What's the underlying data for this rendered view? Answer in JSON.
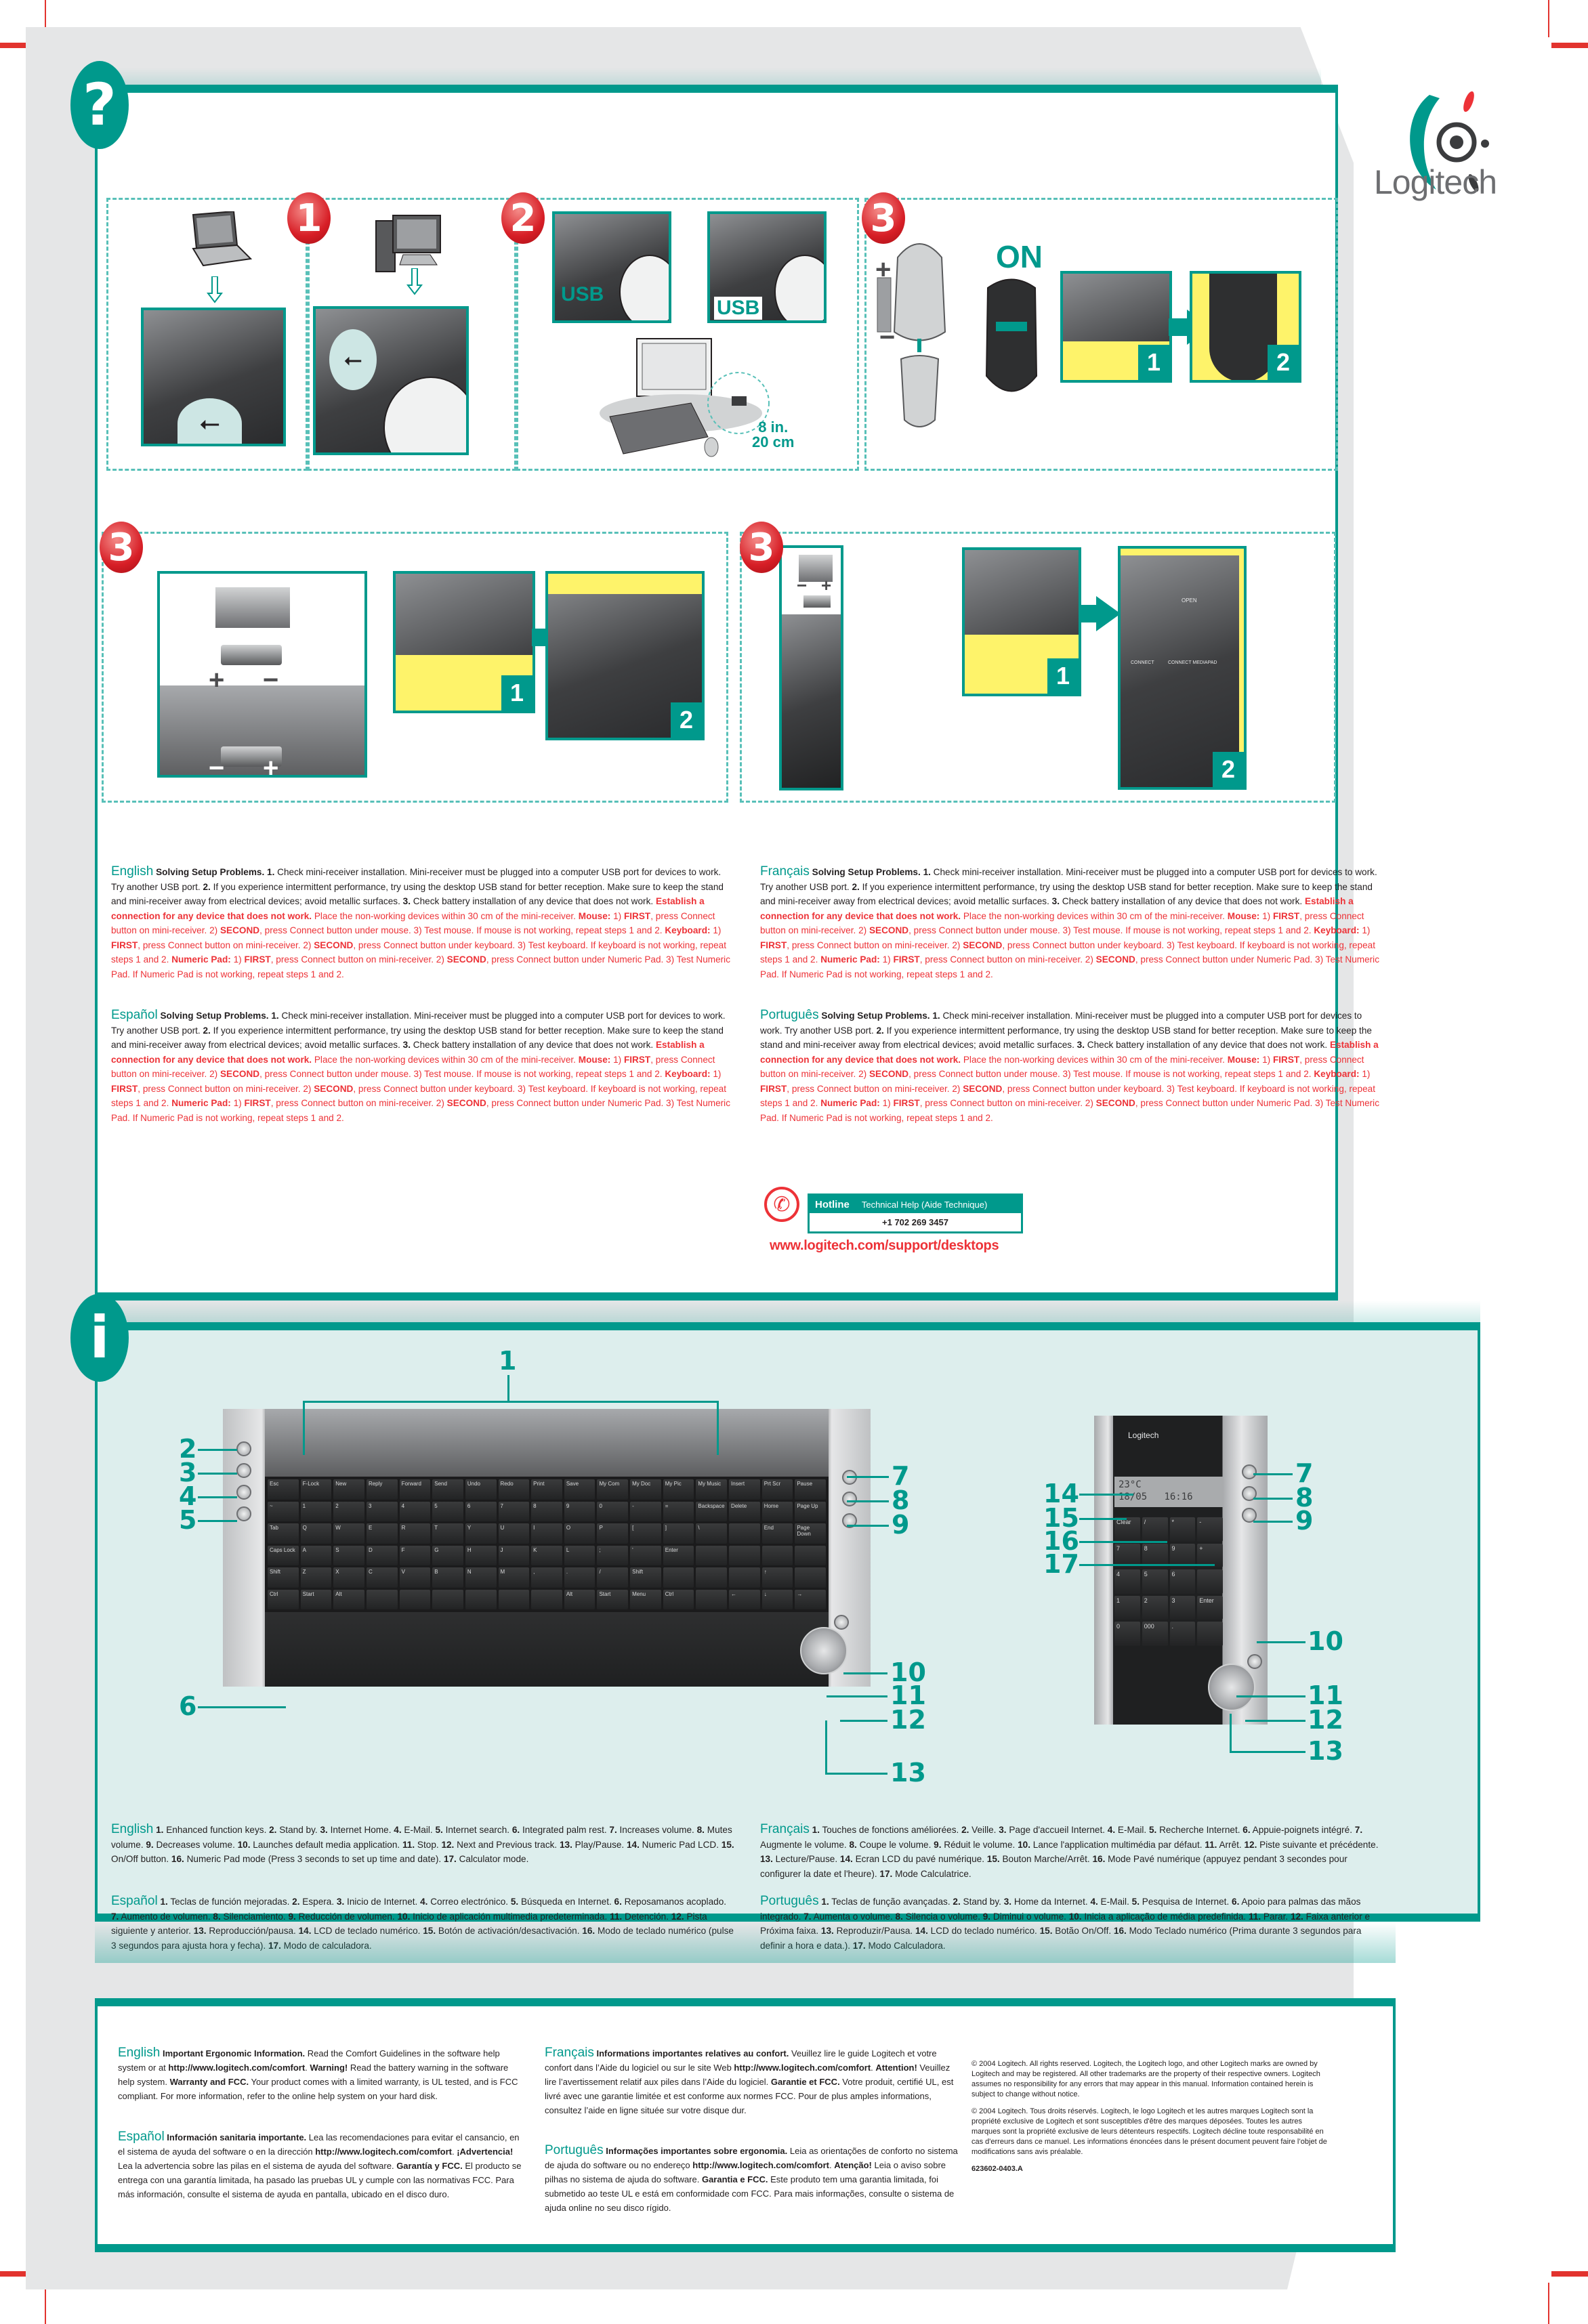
{
  "brand": {
    "name": "Logitech",
    "accent": "#00998c",
    "alert": "#ed3237"
  },
  "badges": {
    "help": "?",
    "info": "i"
  },
  "setup": {
    "steps": [
      {
        "number": "1"
      },
      {
        "number": "2",
        "port_label_a": "USB",
        "port_label_b": "USB",
        "distance_in": "8 in.",
        "distance_cm": "20 cm",
        "monitor_brand": "Logitech"
      },
      {
        "number": "3",
        "power_label": "ON",
        "sub_steps": [
          "1",
          "2"
        ],
        "plus": "+",
        "minus": "−"
      },
      {
        "number": "3",
        "sub_steps": [
          "1",
          "2"
        ],
        "plus": "+",
        "minus": "−"
      },
      {
        "number": "3",
        "sub_steps": [
          "1",
          "2"
        ],
        "plus": "+",
        "minus": "−",
        "panel_label": "CONNECT MEDIAPAD",
        "open_label": "OPEN",
        "connect_label": "CONNECT"
      }
    ]
  },
  "troubleshooting": {
    "blocks": [
      {
        "lang": "English"
      },
      {
        "lang": "Español"
      },
      {
        "lang": "Français"
      },
      {
        "lang": "Português"
      }
    ],
    "title": "Solving Setup Problems.",
    "n1": "1.",
    "t1": " Check mini-receiver installation. Mini-receiver must be plugged into a computer USB port for devices to work. Try another USB port. ",
    "n2": "2.",
    "t2": " If you experience intermittent performance, try using the desktop USB stand for better reception. Make sure to keep the stand and mini-receiver away from electrical devices; avoid metallic surfaces. ",
    "n3": "3.",
    "t3": " Check battery installation of any device that does not work. ",
    "establish": "Establish a connection for any device that does not work.",
    "place": " Place the non-working devices within 30 cm of the mini-receiver. ",
    "mouse_label": "Mouse:",
    "first": "FIRST",
    "second": "SECOND",
    "mouse_1": " 1) ",
    "mouse_2": ", press Connect button on mini-receiver. 2) ",
    "mouse_3": ", press Connect button under mouse. 3) Test mouse. If mouse is not working, repeat steps 1 and 2. ",
    "kb_label": "Keyboard:",
    "kb_1": " 1) ",
    "kb_2": ", press Connect button on mini-receiver. 2) ",
    "kb_3": ", press Connect button under keyboard. 3) Test keyboard. If keyboard is not working, repeat steps 1 and 2. ",
    "np_label": "Numeric Pad:",
    "np_1": " 1) ",
    "np_2": ", press Connect button on mini-receiver. 2) ",
    "np_3": ", press Connect button under Numeric Pad. 3) Test Numeric Pad. If Numeric Pad is not working, repeat steps 1 and 2."
  },
  "hotline": {
    "label": "Hotline",
    "subtitle": "Technical Help (Aide Technique)",
    "phone": "+1 702 269 3457",
    "url": "www.logitech.com/support/desktops",
    "icon": "phone-icon"
  },
  "product": {
    "keyboard": {
      "fn_keys": [
        "Esc",
        "F-Lock",
        "New",
        "Reply",
        "Forward",
        "Send",
        "Undo",
        "Redo",
        "Print",
        "Save",
        "My Com",
        "My Doc",
        "My Pic",
        "My Music",
        "Insert",
        "Prt Scr",
        "Pause"
      ],
      "row1": [
        "~",
        "1",
        "2",
        "3",
        "4",
        "5",
        "6",
        "7",
        "8",
        "9",
        "0",
        "-",
        "=",
        "Backspace",
        "Delete",
        "Home",
        "Page Up"
      ],
      "row2": [
        "Tab",
        "Q",
        "W",
        "E",
        "R",
        "T",
        "Y",
        "U",
        "I",
        "O",
        "P",
        "[",
        "]",
        "\\",
        "",
        "End",
        "Page Down"
      ],
      "row3": [
        "Caps Lock",
        "A",
        "S",
        "D",
        "F",
        "G",
        "H",
        "J",
        "K",
        "L",
        ";",
        "'",
        "Enter",
        "",
        "",
        "",
        ""
      ],
      "row4": [
        "Shift",
        "Z",
        "X",
        "C",
        "V",
        "B",
        "N",
        "M",
        ",",
        ".",
        "/",
        "Shift",
        "",
        "",
        "",
        "↑",
        ""
      ],
      "row5": [
        "Ctrl",
        "Start",
        "Alt",
        "",
        "",
        "",
        "",
        "",
        "",
        "Alt",
        "Start",
        "Menu",
        "Ctrl",
        "",
        "←",
        "↓",
        "→"
      ]
    },
    "numpad": {
      "lcd_line1": "23°C",
      "lcd_date": "18/05",
      "lcd_time": "16:16",
      "brand": "Logitech",
      "keys": [
        "Clear",
        "/",
        "*",
        "-",
        "7",
        "8",
        "9",
        "+",
        "4",
        "5",
        "6",
        "",
        "1",
        "2",
        "3",
        "Enter",
        "0",
        "000",
        ".",
        ""
      ]
    },
    "callouts": [
      "1",
      "2",
      "3",
      "4",
      "5",
      "6",
      "7",
      "8",
      "9",
      "10",
      "11",
      "12",
      "13",
      "14",
      "15",
      "16",
      "17"
    ]
  },
  "features": {
    "english": {
      "lang": "English",
      "items": [
        [
          "1.",
          " Enhanced function keys.  "
        ],
        [
          "2.",
          " Stand by.  "
        ],
        [
          "3.",
          " Internet Home.  "
        ],
        [
          "4.",
          " E-Mail.  "
        ],
        [
          "5.",
          " Internet search.  "
        ],
        [
          "6.",
          " Integrated palm rest.  "
        ],
        [
          "7.",
          " Increases volume.  "
        ],
        [
          "8.",
          " Mutes volume.  "
        ],
        [
          "9.",
          " Decreases volume.  "
        ],
        [
          "10.",
          " Launches default media application.  "
        ],
        [
          "11.",
          " Stop.  "
        ],
        [
          "12.",
          " Next and Previous track.  "
        ],
        [
          "13.",
          " Play/Pause.  "
        ],
        [
          "14.",
          " Numeric Pad LCD.  "
        ],
        [
          "15.",
          " On/Off button.  "
        ],
        [
          "16.",
          " Numeric Pad mode (Press 3 seconds to set up time and date).  "
        ],
        [
          "17.",
          " Calculator mode."
        ]
      ]
    },
    "espanol": {
      "lang": "Español",
      "items": [
        [
          "1.",
          " Teclas de función mejoradas.  "
        ],
        [
          "2.",
          " Espera.  "
        ],
        [
          "3.",
          " Inicio de Internet.  "
        ],
        [
          "4.",
          " Correo electrónico.  "
        ],
        [
          "5.",
          " Búsqueda en Internet.  "
        ],
        [
          "6.",
          " Reposamanos acoplado.  "
        ],
        [
          "7.",
          " Aumento de volumen.  "
        ],
        [
          "8.",
          " Silenciamiento.  "
        ],
        [
          "9.",
          " Reducción de volumen.  "
        ],
        [
          "10.",
          " Inicio de aplicación multimedia predeterminada.  "
        ],
        [
          "11.",
          " Detención.  "
        ],
        [
          "12.",
          " Pista siguiente y anterior.  "
        ],
        [
          "13.",
          " Reproducción/pausa.  "
        ],
        [
          "14.",
          " LCD de teclado numérico.  "
        ],
        [
          "15.",
          " Botón de activación/desactivación.  "
        ],
        [
          "16.",
          " Modo de teclado numérico (pulse 3 segundos para ajusta hora y fecha).  "
        ],
        [
          "17.",
          " Modo de calculadora."
        ]
      ]
    },
    "francais": {
      "lang": "Français",
      "items": [
        [
          "1.",
          " Touches de fonctions améliorées.  "
        ],
        [
          "2.",
          " Veille.  "
        ],
        [
          "3.",
          " Page d'accueil Internet.  "
        ],
        [
          "4.",
          " E-Mail.  "
        ],
        [
          "5.",
          " Recherche Internet.  "
        ],
        [
          "6.",
          " Appuie-poignets intégré.  "
        ],
        [
          "7.",
          " Augmente le volume.  "
        ],
        [
          "8.",
          " Coupe le volume.  "
        ],
        [
          "9.",
          " Réduit le volume.  "
        ],
        [
          "10.",
          " Lance l'application multimédia par défaut.  "
        ],
        [
          "11.",
          " Arrêt.  "
        ],
        [
          "12.",
          " Piste suivante et précédente.  "
        ],
        [
          "13.",
          " Lecture/Pause.  "
        ],
        [
          "14.",
          " Ecran LCD du pavé numérique.  "
        ],
        [
          "15.",
          " Bouton Marche/Arrêt.  "
        ],
        [
          "16.",
          " Mode Pavé numérique (appuyez pendant 3 secondes pour configurer la date et l'heure).  "
        ],
        [
          "17.",
          " Mode Calculatrice."
        ]
      ]
    },
    "portugues": {
      "lang": "Português",
      "items": [
        [
          "1.",
          " Teclas de função avançadas.  "
        ],
        [
          "2.",
          " Stand by.  "
        ],
        [
          "3.",
          " Home da Internet.  "
        ],
        [
          "4.",
          " E-Mail.  "
        ],
        [
          "5.",
          " Pesquisa de Internet.  "
        ],
        [
          "6.",
          " Apoio para palmas das mãos integrado.  "
        ],
        [
          "7.",
          " Aumenta o volume.  "
        ],
        [
          "8.",
          " Silencia o volume.  "
        ],
        [
          "9.",
          " Diminui o volume.  "
        ],
        [
          "10.",
          " Inicia a aplicação de média predefinida.  "
        ],
        [
          "11.",
          " Parar.  "
        ],
        [
          "12.",
          " Faixa anterior e Próxima faixa.  "
        ],
        [
          "13.",
          " Reproduzir/Pausa.  "
        ],
        [
          "14.",
          " LCD do teclado numérico.  "
        ],
        [
          "15.",
          " Botão On/Off.  "
        ],
        [
          "16.",
          " Modo Teclado numérico (Prima durante 3 segundos para definir a hora e data.).  "
        ],
        [
          "17.",
          " Modo Calculadora."
        ]
      ]
    }
  },
  "ergonomics": {
    "english": {
      "lang": "English",
      "title": "Important Ergonomic Information.",
      "t1": " Read the Comfort Guidelines in the software help system or at ",
      "url": "http://www.logitech.com/comfort",
      "t2": ". ",
      "warn": "Warning!",
      "t3": " Read the battery warning in the software help system. ",
      "wfcc": "Warranty and FCC.",
      "t4": " Your product comes with a limited  warranty, is UL tested, and is FCC compliant. For more information, refer to the online help system on your hard disk."
    },
    "espanol": {
      "lang": "Español",
      "title": "Información sanitaria importante.",
      "t1": " Lea las recomendaciones para evitar el cansancio, en el sistema de ayuda del software o en la dirección ",
      "url": "http://www.logitech.com/comfort",
      "t2": ". ",
      "warn": "¡Advertencia!",
      "t3": " Lea la advertencia sobre las pilas en el sistema de ayuda del software. ",
      "wfcc": "Garantía y FCC.",
      "t4": " El producto se entrega con una garantía limitada, ha pasado las pruebas UL y cumple con las normativas FCC. Para más información, consulte el sistema de ayuda en pantalla, ubicado en el disco duro."
    },
    "francais": {
      "lang": "Français",
      "title": "Informations importantes relatives au confort.",
      "t1": " Veuillez lire le guide Logitech et votre confort dans l’Aide du logiciel ou sur le site Web ",
      "url": "http://www.logitech.com/comfort",
      "t2": ". ",
      "warn": "Attention!",
      "t3": " Veuillez lire l’avertissement relatif aux piles dans l’Aide du logiciel. ",
      "wfcc": "Garantie et FCC.",
      "t4": " Votre produit, certifié UL, est livré avec une garantie limitée et est conforme aux normes FCC. Pour de plus amples informations, consultez l’aide en ligne située sur votre disque dur."
    },
    "portugues": {
      "lang": "Português",
      "title": "Informações importantes sobre ergonomia.",
      "t1": " Leia as orientações de conforto no sistema de ajuda do software ou no endereço ",
      "url": "http://www.logitech.com/comfort",
      "t2": ". ",
      "warn": "Atenção!",
      "t3": " Leia o aviso sobre pilhas no sistema de ajuda do software. ",
      "wfcc": "Garantia e FCC.",
      "t4": " Este produto tem uma garantia limitada, foi submetido ao teste UL e está em conformidade com FCC. Para mais informações, consulte o sistema de ajuda online no seu disco rígido."
    }
  },
  "legal": {
    "en": "© 2004 Logitech. All rights reserved. Logitech, the Logitech logo, and other Logitech marks are owned by Logitech and may be registered. All other trademarks are the property of their respective owners. Logitech assumes no responsibility for any errors that may appear in this manual. Information contained herein is subject to change without notice.",
    "fr": "© 2004 Logitech. Tous droits réservés. Logitech, le logo Logitech et les autres marques Logitech sont la propriété exclusive de Logitech et sont susceptibles d'être des marques déposées. Toutes les autres marques sont la propriété exclusive de leurs détenteurs respectifs. Logitech décline toute responsabilité en cas d'erreurs dans ce manuel. Les informations énoncées dans le présent document peuvent faire l’objet de modifications sans avis préalable.",
    "part_number": "623602-0403.A"
  }
}
